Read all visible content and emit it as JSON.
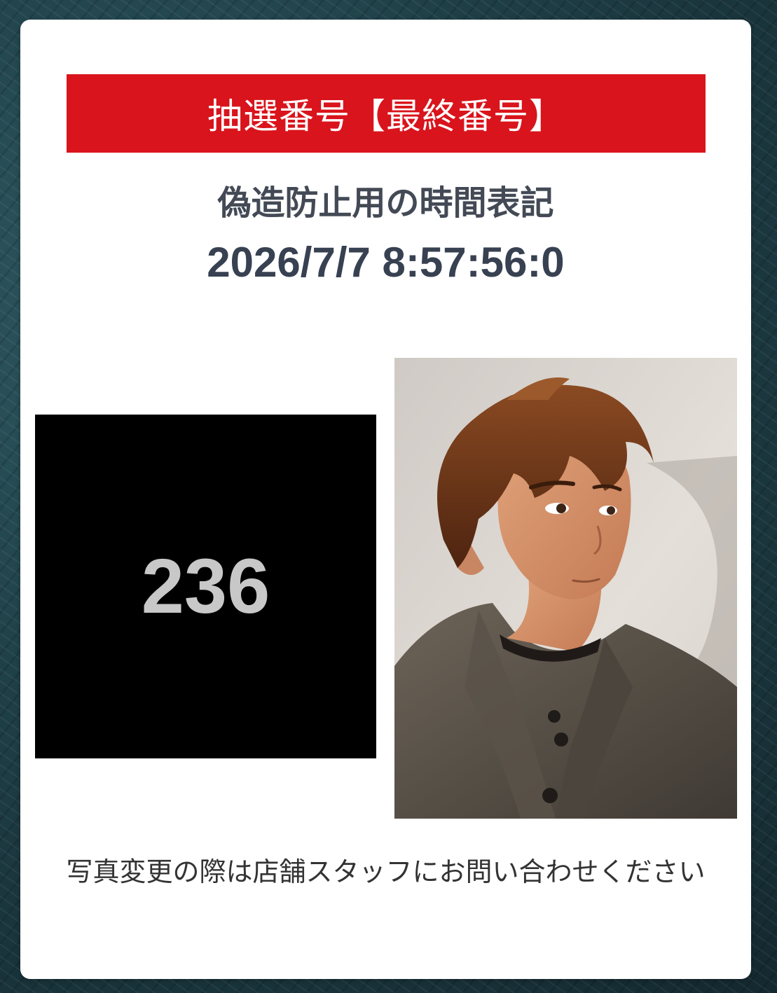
{
  "card": {
    "banner_title": "抽選番号【最終番号】",
    "subtitle": "偽造防止用の時間表記",
    "timestamp": "2026/7/7 8:57:56:0",
    "lottery_number": "236",
    "notice": "写真変更の際は店舗スタッフにお問い合わせください"
  },
  "colors": {
    "banner_red": "#d9141c",
    "number_bg": "#000000",
    "number_text": "#c8c8c8",
    "text_dark": "#434a55"
  },
  "icons": {
    "profile_photo": "anime-style-man-portrait"
  }
}
